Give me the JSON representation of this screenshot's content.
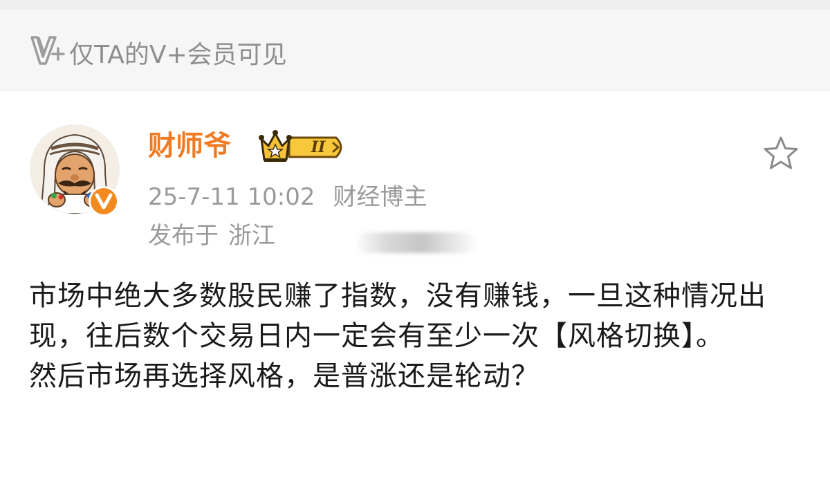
{
  "visibility_banner": {
    "icon": "vplus-icon",
    "text": "仅TA的V+会员可见"
  },
  "author": {
    "name": "财师爷",
    "avatar_icon": "avatar",
    "verified_icon": "verified-v-icon",
    "member_badge_icon": "crown-badge-icon",
    "member_badge_label": "II",
    "time": "25-7-11 10:02",
    "role": "财经博主",
    "location_prefix": "发布于",
    "location": "浙江"
  },
  "actions": {
    "favorite_icon": "star-icon"
  },
  "post": {
    "paragraphs": [
      "市场中绝大多数股民赚了指数，没有赚钱，一旦这种情况出现，往后数个交易日内一定会有至少一次【风格切换】。",
      "然后市场再选择风格，是普涨还是轮动？"
    ]
  },
  "colors": {
    "username": "#f07b22",
    "meta_text": "#9a9a9a",
    "banner_text": "#8e8e8e",
    "body_text": "#1a1a1a",
    "badge_gold": "#f5c23a",
    "verified_orange": "#f28a1f"
  }
}
